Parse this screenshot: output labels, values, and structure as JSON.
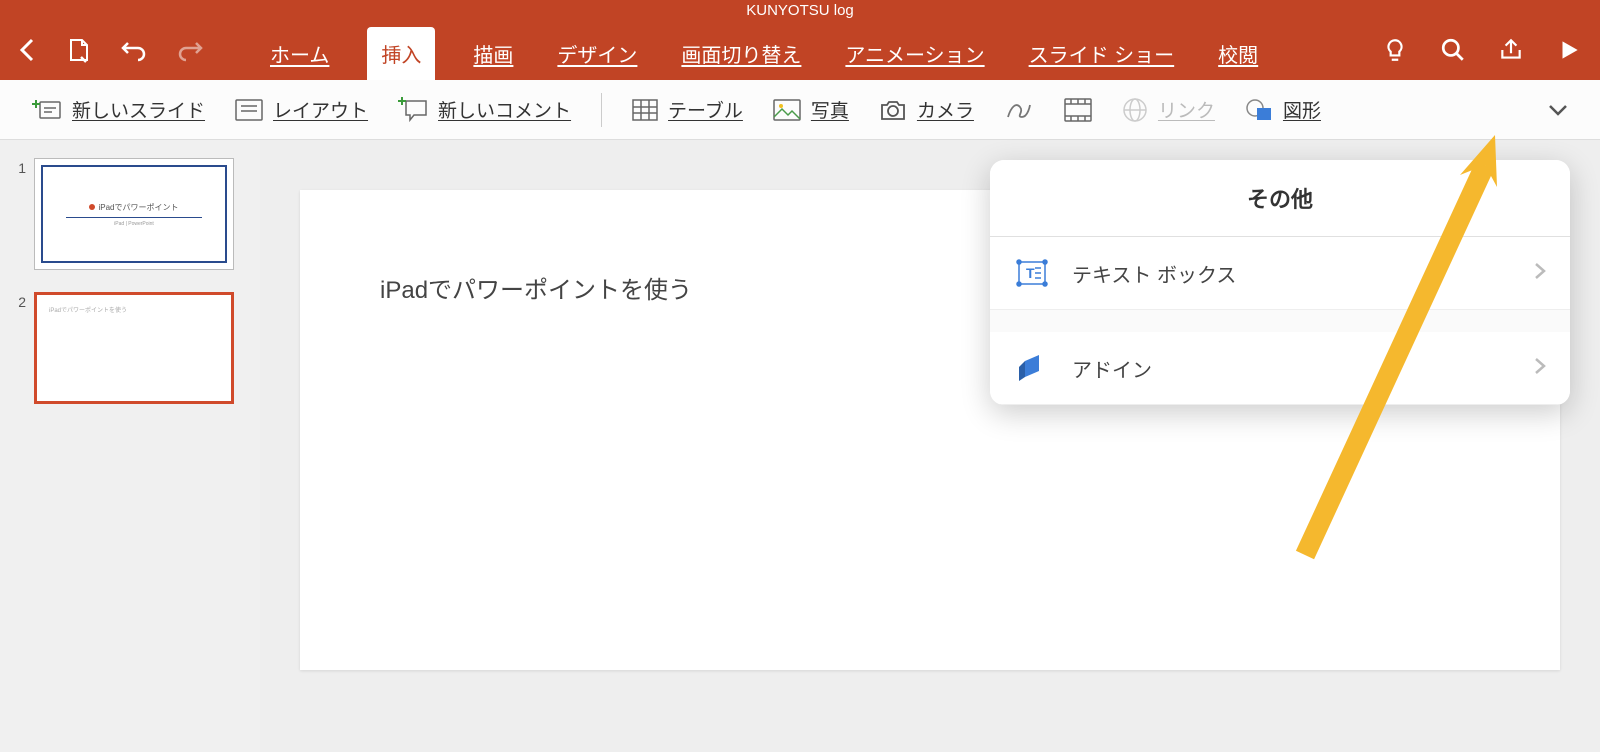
{
  "title": "KUNYOTSU log",
  "tabs": [
    "ホーム",
    "挿入",
    "描画",
    "デザイン",
    "画面切り替え",
    "アニメーション",
    "スライド ショー",
    "校閲"
  ],
  "active_tab_index": 1,
  "ribbon": {
    "new_slide": "新しいスライド",
    "layout": "レイアウト",
    "new_comment": "新しいコメント",
    "table": "テーブル",
    "photo": "写真",
    "camera": "カメラ",
    "link": "リンク",
    "shape": "図形"
  },
  "thumbnails": [
    {
      "num": "1",
      "title": "iPadでパワーポイント",
      "sub": "iPad | PowerPoint"
    },
    {
      "num": "2",
      "text": "iPadでパワーポイントを使う"
    }
  ],
  "slide_text": "iPadでパワーポイントを使う",
  "popover": {
    "title": "その他",
    "items": [
      "テキスト ボックス",
      "アドイン"
    ]
  }
}
